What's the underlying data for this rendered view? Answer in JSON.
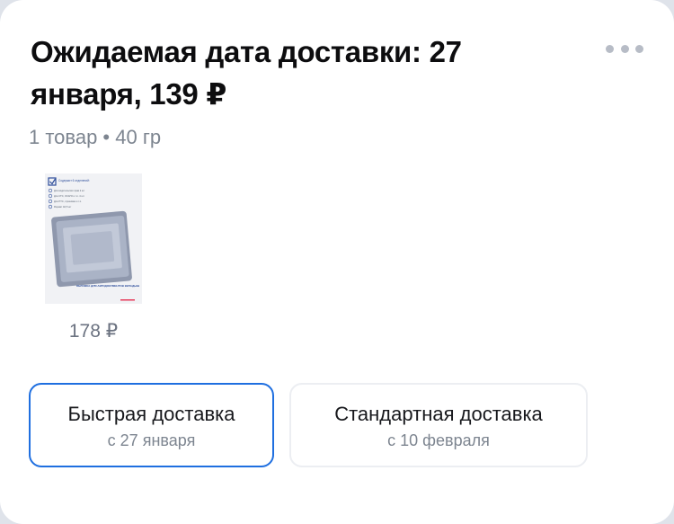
{
  "header": {
    "title": "Ожидаемая дата доставки: 27 января, 139 ₽",
    "meta": "1 товар • 40 гр"
  },
  "items": [
    {
      "price": "178 ₽",
      "image_text": {
        "badge_title": "Содержит 6 отделений:",
        "lines": [
          "Для водительских прав 2 шт",
          "Для СТС, ОСАГО и т.п. 4 шт",
          "Для ПТС, страховки и т.п.",
          "Формат А6,5 шт"
        ],
        "caption": "ОБЛОЖКА ДЛЯ АВТОДОКУМЕНТОВ ВКЛАДЫШ"
      }
    }
  ],
  "delivery_options": [
    {
      "title": "Быстрая доставка",
      "subtitle": "с 27 января",
      "selected": true
    },
    {
      "title": "Стандартная доставка",
      "subtitle": "с 10 февраля",
      "selected": false
    }
  ],
  "colors": {
    "accent": "#1f6fe0",
    "title": "#0d0d0f",
    "secondary": "#7d8590"
  }
}
